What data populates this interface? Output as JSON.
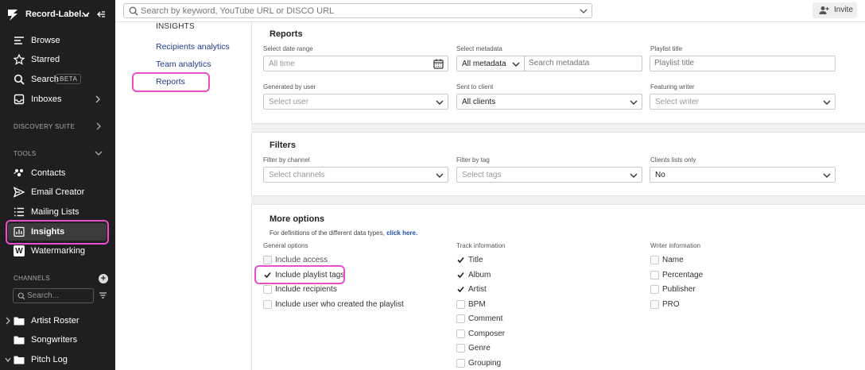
{
  "workspace": {
    "name": "Record-Label..."
  },
  "nav": {
    "browse": "Browse",
    "starred": "Starred",
    "search": "Search",
    "search_badge": "BETA",
    "inboxes": "Inboxes"
  },
  "sections": {
    "discovery": "DISCOVERY SUITE",
    "tools": "TOOLS",
    "channels": "CHANNELS"
  },
  "tools": {
    "contacts": "Contacts",
    "email_creator": "Email Creator",
    "mailing_lists": "Mailing Lists",
    "insights": "Insights",
    "watermarking": "Watermarking",
    "watermark_letter": "W"
  },
  "channels": {
    "search_placeholder": "Search...",
    "add_glyph": "+",
    "items": [
      "Artist Roster",
      "Songwriters",
      "Pitch Log"
    ]
  },
  "topbar": {
    "search_placeholder": "Search by keyword, YouTube URL or DISCO URL",
    "invite_label": "Invite"
  },
  "submenu": {
    "header": "INSIGHTS",
    "items": [
      "Recipients analytics",
      "Team analytics",
      "Reports"
    ]
  },
  "reports": {
    "title": "Reports",
    "date_range": {
      "label": "Select date range",
      "value": "All time"
    },
    "metadata": {
      "label": "Select metadata",
      "value": "All metadata",
      "search_placeholder": "Search metadata"
    },
    "playlist_title": {
      "label": "Playlist title",
      "placeholder": "Playlist title"
    },
    "generated_by": {
      "label": "Generated by user",
      "placeholder": "Select user"
    },
    "sent_to": {
      "label": "Sent to client",
      "value": "All clients"
    },
    "featuring": {
      "label": "Featuring writer",
      "placeholder": "Select writer"
    }
  },
  "filters": {
    "title": "Filters",
    "channel": {
      "label": "Filter by channel",
      "placeholder": "Select channels"
    },
    "tag": {
      "label": "Filter by tag",
      "placeholder": "Select tags"
    },
    "clients_only": {
      "label": "Clients lists only",
      "value": "No"
    }
  },
  "more": {
    "title": "More options",
    "definitions_text": "For definitions of the different data types,",
    "definitions_link": "click here.",
    "general": {
      "label": "General options",
      "options": [
        {
          "label": "Include access",
          "checked": false,
          "disabled": true
        },
        {
          "label": "Include playlist tags",
          "checked": true,
          "disabled": false
        },
        {
          "label": "Include recipients",
          "checked": false,
          "disabled": false
        },
        {
          "label": "Include user who created the playlist",
          "checked": false,
          "disabled": false
        }
      ]
    },
    "track": {
      "label": "Track information",
      "options": [
        {
          "label": "Title",
          "checked": true
        },
        {
          "label": "Album",
          "checked": true
        },
        {
          "label": "Artist",
          "checked": true
        },
        {
          "label": "BPM",
          "checked": false
        },
        {
          "label": "Comment",
          "checked": false
        },
        {
          "label": "Composer",
          "checked": false
        },
        {
          "label": "Genre",
          "checked": false
        },
        {
          "label": "Grouping",
          "checked": false
        }
      ]
    },
    "writer": {
      "label": "Writer information",
      "options": [
        {
          "label": "Name",
          "checked": false
        },
        {
          "label": "Percentage",
          "checked": false
        },
        {
          "label": "Publisher",
          "checked": false
        },
        {
          "label": "PRO",
          "checked": false
        }
      ]
    }
  },
  "colors": {
    "sidebar_bg": "#1f1f21",
    "highlight": "#e94fc8",
    "link": "#1f3b8a"
  }
}
